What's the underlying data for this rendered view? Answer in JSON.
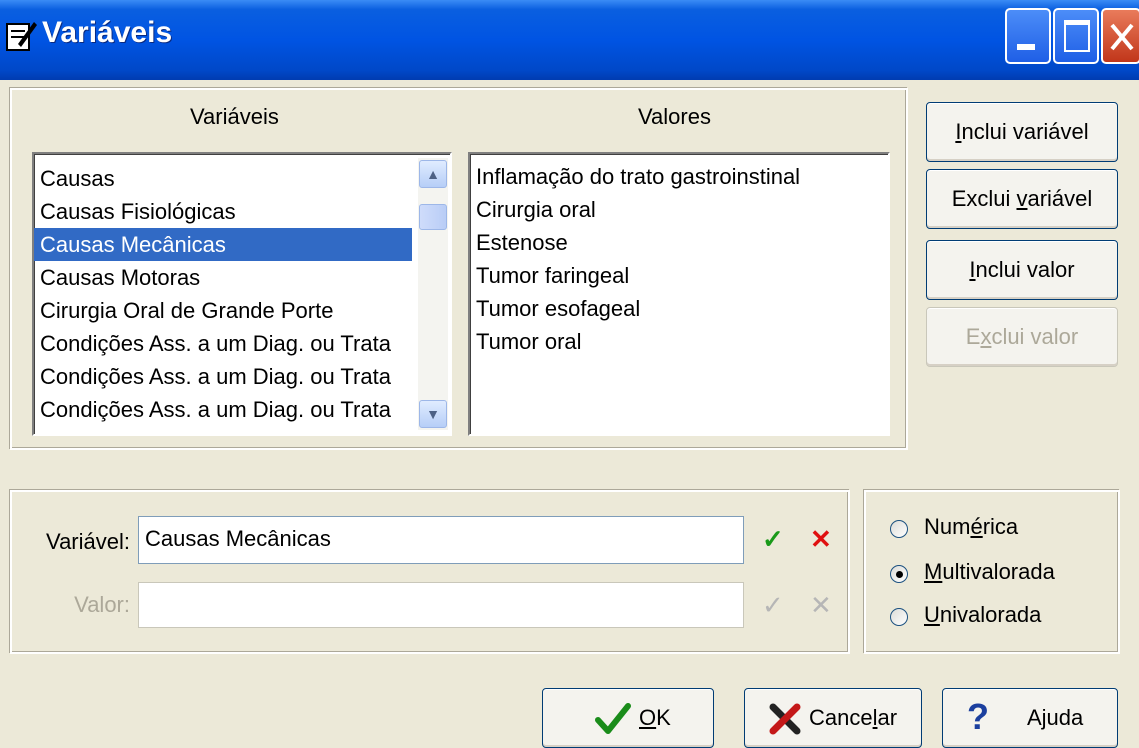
{
  "window": {
    "title": "Variáveis",
    "icon": "notepad-pencil-icon"
  },
  "titlebar_buttons": {
    "minimize": "minimize-icon",
    "maximize": "maximize-icon",
    "close": "close-icon"
  },
  "variables_panel": {
    "header": "Variáveis",
    "items": [
      "Causas",
      "Causas Fisiológicas",
      "Causas Mecânicas",
      "Causas Motoras",
      "Cirurgia Oral de Grande Porte",
      "Condições Ass. a um Diag. ou Trata",
      "Condições Ass. a um Diag. ou Trata",
      "Condições Ass. a um Diag. ou Trata"
    ],
    "selected": "Causas Mecânicas"
  },
  "values_panel": {
    "header": "Valores",
    "items": [
      "Inflamação do trato gastroinstinal",
      "Cirurgia oral",
      "Estenose",
      "Tumor faringeal",
      "Tumor esofageal",
      "Tumor oral"
    ]
  },
  "side_buttons": {
    "add_variable": {
      "pre": "",
      "u": "I",
      "post": "nclui variável"
    },
    "remove_variable": {
      "pre": "Exclui ",
      "u": "v",
      "post": "ariável"
    },
    "add_value": {
      "pre": "",
      "u": "I",
      "post": "nclui valor"
    },
    "remove_value": {
      "pre": "E",
      "u": "x",
      "post": "clui valor"
    }
  },
  "edit": {
    "variable_label": "Variável:",
    "variable_value": "Causas Mecânicas",
    "value_label": "Valor:",
    "value_value": "",
    "confirm_glyph": "✓",
    "cancel_glyph": "✕"
  },
  "type_options": {
    "numeric": {
      "pre": "Num",
      "u": "é",
      "post": "rica"
    },
    "multivalued": {
      "pre": "",
      "u": "M",
      "post": "ultivalorada"
    },
    "univalued": {
      "pre": "",
      "u": "U",
      "post": "nivalorada"
    },
    "selected": "Multivalorada"
  },
  "bottom_buttons": {
    "ok": {
      "pre": "",
      "u": "O",
      "post": "K",
      "icon": "green-check-icon"
    },
    "cancel": {
      "pre": "Cance",
      "u": "l",
      "post": "ar",
      "icon": "red-x-icon"
    },
    "help": {
      "label": "Ajuda",
      "icon": "help-question-icon"
    }
  },
  "colors": {
    "titlebar": "#0054e3",
    "selection": "#316ac5",
    "face": "#ece9d8"
  }
}
